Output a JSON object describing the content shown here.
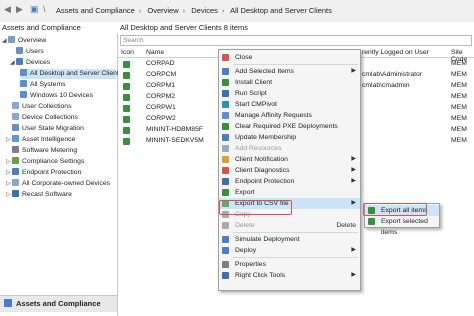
{
  "breadcrumb": [
    "Assets and Compliance",
    "Overview",
    "Devices",
    "All Desktop and Server Clients"
  ],
  "left_pane": {
    "title": "Assets and Compliance",
    "items": [
      {
        "label": "Overview",
        "icon": "overview-icon"
      },
      {
        "label": "Users",
        "icon": "users-icon"
      },
      {
        "label": "Devices",
        "icon": "devices-icon"
      },
      {
        "label": "All Desktop and Server Clients",
        "icon": "collection-icon",
        "selected": true
      },
      {
        "label": "All Systems",
        "icon": "collection-icon"
      },
      {
        "label": "Windows 10 Devices",
        "icon": "collection-icon"
      },
      {
        "label": "User Collections",
        "icon": "user-collections-icon"
      },
      {
        "label": "Device Collections",
        "icon": "device-collections-icon"
      },
      {
        "label": "User State Migration",
        "icon": "user-state-migration-icon"
      },
      {
        "label": "Asset Intelligence",
        "icon": "asset-intelligence-icon"
      },
      {
        "label": "Software Metering",
        "icon": "software-metering-icon"
      },
      {
        "label": "Compliance Settings",
        "icon": "compliance-settings-icon"
      },
      {
        "label": "Endpoint Protection",
        "icon": "endpoint-protection-icon"
      },
      {
        "label": "All Corporate-owned Devices",
        "icon": "corporate-devices-icon"
      },
      {
        "label": "Recast Software",
        "icon": "recast-software-icon"
      }
    ],
    "bottom_workspace": "Assets and Compliance"
  },
  "main_pane": {
    "title": "All Desktop and Server Clients 8 items",
    "search_placeholder": "Search",
    "columns": {
      "icon": "Icon",
      "name": "Name",
      "user": "rently Logged on User",
      "site": "Site Code"
    },
    "rows": [
      {
        "name": "CORPAD",
        "user": "",
        "site": "MEM"
      },
      {
        "name": "CORPCM",
        "user": "cmlab\\Administrator",
        "site": "MEM"
      },
      {
        "name": "CORPM1",
        "user": "cmlab\\cmadmin",
        "site": "MEM"
      },
      {
        "name": "CORPM2",
        "user": "",
        "site": "MEM"
      },
      {
        "name": "CORPW1",
        "user": "",
        "site": "MEM"
      },
      {
        "name": "CORPW2",
        "user": "",
        "site": "MEM"
      },
      {
        "name": "MININT-HDBM85F",
        "user": "",
        "site": "MEM"
      },
      {
        "name": "MININT-SEDKV5M",
        "user": "",
        "site": "MEM"
      }
    ]
  },
  "context_menu": {
    "items": [
      {
        "label": "Close"
      },
      {
        "label": "Add Selected Items",
        "submenu": true
      },
      {
        "label": "Install Client"
      },
      {
        "label": "Run Script"
      },
      {
        "label": "Start CMPivot"
      },
      {
        "label": "Manage Affinity Requests"
      },
      {
        "label": "Clear Required PXE Deployments"
      },
      {
        "label": "Update Membership"
      },
      {
        "label": "Add Resources",
        "disabled": true
      },
      {
        "label": "Client Notification",
        "submenu": true
      },
      {
        "label": "Client Diagnostics",
        "submenu": true
      },
      {
        "label": "Endpoint Protection",
        "submenu": true
      },
      {
        "label": "Export"
      },
      {
        "label": "Export to CSV file",
        "submenu": true,
        "highlighted": true
      },
      {
        "label": "Copy",
        "disabled": true
      },
      {
        "label": "Delete",
        "disabled": true,
        "shortcut": "Delete"
      },
      {
        "label": "Simulate Deployment"
      },
      {
        "label": "Deploy",
        "submenu": true
      },
      {
        "label": "Properties"
      },
      {
        "label": "Right Click Tools",
        "submenu": true
      }
    ]
  },
  "submenu": {
    "items": [
      {
        "label": "Export all items",
        "highlighted": true
      },
      {
        "label": "Export selected items"
      }
    ]
  },
  "colors": {
    "selection": "#cce4f7",
    "highlight_border": "#d9534f",
    "client_icon": "#3a8f3a"
  }
}
